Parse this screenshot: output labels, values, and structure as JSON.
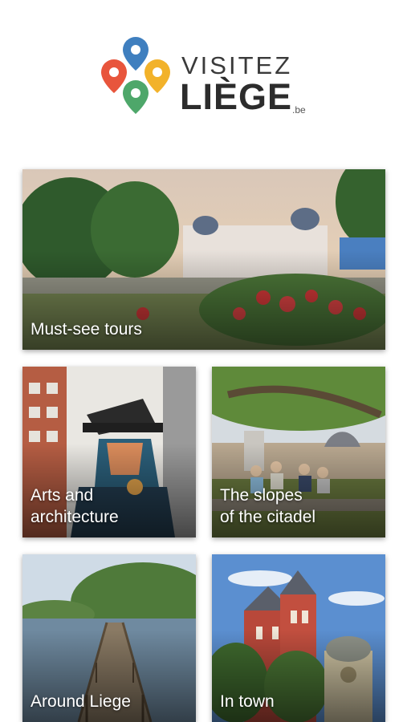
{
  "brand": {
    "word1": "VISITEZ",
    "word2": "LIÈGE",
    "tld": ".be",
    "pin_colors": [
      "#e8553c",
      "#3f7fbf",
      "#f2b22a",
      "#4ea76a"
    ]
  },
  "tours": [
    {
      "title": "Must-see tours",
      "icon": "photo-opera-house-garden"
    },
    {
      "title": "Arts and\narchitecture",
      "icon": "photo-street-mural"
    },
    {
      "title": "The slopes\nof the citadel",
      "icon": "photo-hillside-view"
    },
    {
      "title": "Around Liege",
      "icon": "photo-wooden-footbridge"
    },
    {
      "title": "In town",
      "icon": "photo-red-church"
    }
  ]
}
